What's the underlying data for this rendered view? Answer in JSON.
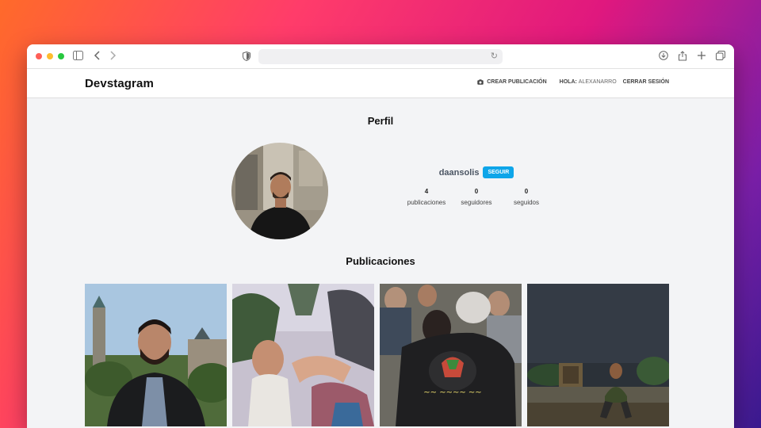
{
  "browser": {
    "address_value": ""
  },
  "header": {
    "brand": "Devstagram",
    "create_label": "Crear Publicación",
    "hola_label": "Hola:",
    "username": "alexanarro",
    "logout_label": "Cerrar Sesión"
  },
  "profile": {
    "title": "Perfil",
    "username": "daansolis",
    "follow_label": "Seguir",
    "stats": [
      {
        "value": "4",
        "label": "publicaciones"
      },
      {
        "value": "0",
        "label": "seguidores"
      },
      {
        "value": "0",
        "label": "seguidos"
      }
    ]
  },
  "posts": {
    "title": "Publicaciones"
  },
  "colors": {
    "accent": "#0ea5e9",
    "page_bg": "#f3f4f6"
  }
}
